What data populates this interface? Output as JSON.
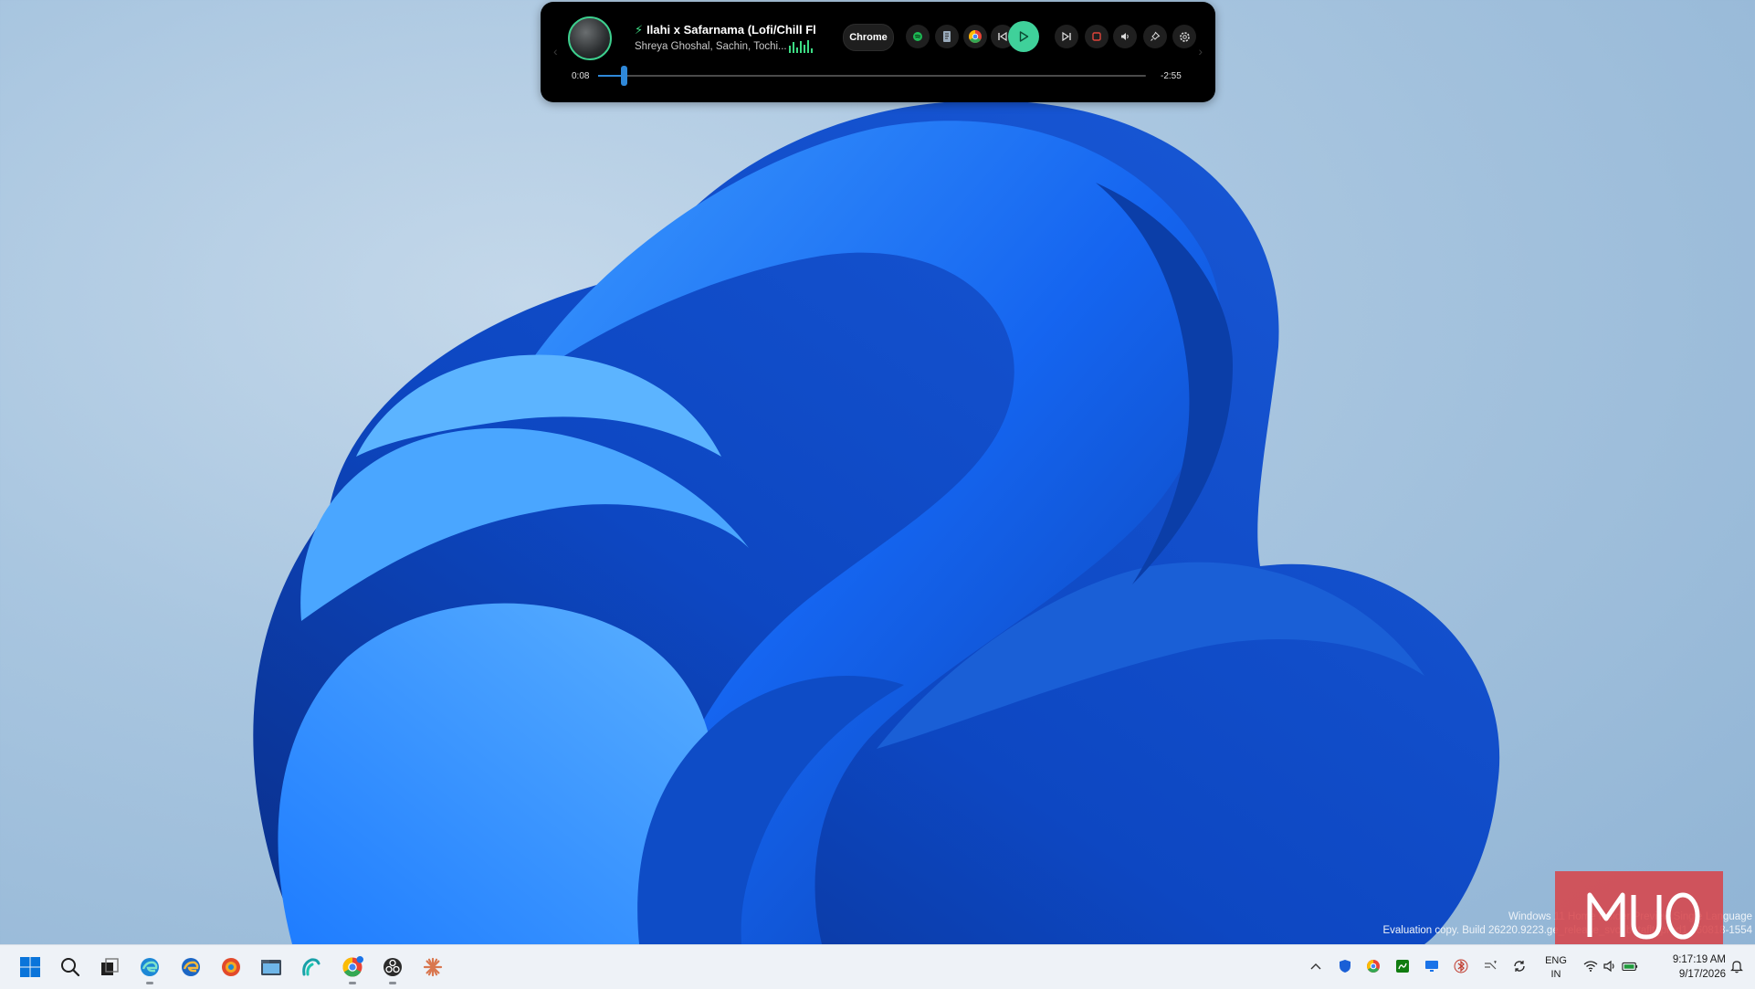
{
  "media_player": {
    "title": "Ilahi x Safarnama (Lofi/Chill Flip",
    "artist": "Shreya Ghoshal, Sachin, Tochi...",
    "source_label": "Chrome",
    "elapsed": "0:08",
    "remaining": "-2:55",
    "progress_fraction": 0.047,
    "accent_color": "#3fd19a",
    "controls": [
      "spotify-icon",
      "notes-icon",
      "chrome-icon",
      "previous-icon",
      "play-icon",
      "next-icon",
      "stop-icon",
      "volume-icon",
      "pin-icon",
      "settings-icon"
    ]
  },
  "watermark": {
    "line1": "Windows 11 Home Insider Preview Single Language",
    "line2": "Evaluation copy. Build 26220.9223.ge_release_svc_betaflt_prod1.260818-1554"
  },
  "logo": {
    "text": "MUO"
  },
  "taskbar": {
    "pinned": [
      "windows-start-icon",
      "search-icon",
      "task-view-icon",
      "edge-beta-icon",
      "edge-dev-icon",
      "edge-canary-icon",
      "file-explorer-icon",
      "copilot-icon",
      "chrome-icon",
      "obs-icon",
      "claude-icon"
    ],
    "tray": [
      "show-hidden-icons-chevron",
      "defender-icon",
      "chrome-tray-icon",
      "xbox-icon",
      "display-icon",
      "bluetooth-icon",
      "onedrive-icon",
      "sync-icon"
    ],
    "language": {
      "line1": "ENG",
      "line2": "IN"
    },
    "clock": {
      "time": "9:17:19 AM",
      "date": "9/17/2026"
    }
  }
}
